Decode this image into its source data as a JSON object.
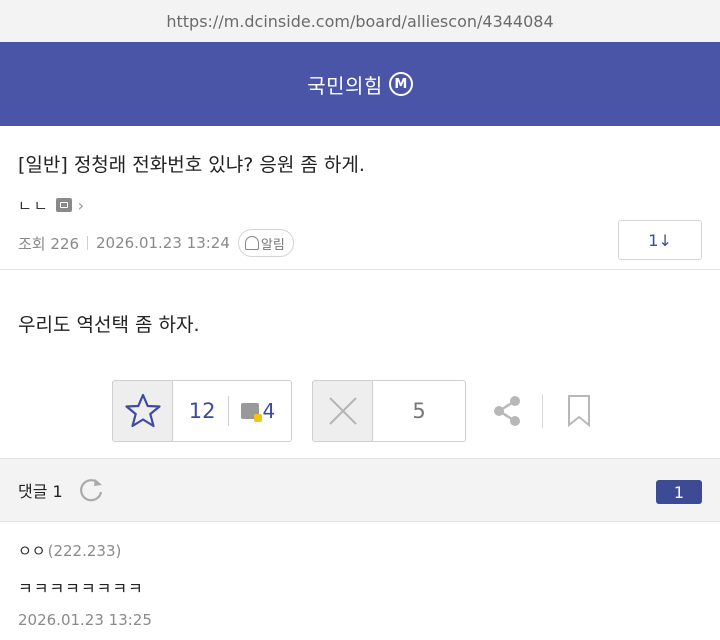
{
  "browser": {
    "url": "https://m.dcinside.com/board/alliescon/4344084"
  },
  "gallery": {
    "name": "국민의힘",
    "badge": "M"
  },
  "post": {
    "title": "[일반] 정청래 전화번호 있냐? 응원 좀 하게.",
    "author": "ㄴㄴ",
    "views_label": "조회 226",
    "date": "2026.01.23 13:24",
    "alarm_label": "알림",
    "comment_jump": "1↓",
    "body": "우리도 역선택 좀 하자."
  },
  "votes": {
    "recommend": "12",
    "fixed_recommend": "4",
    "not_recommend": "5"
  },
  "comments": {
    "label": "댓글 1",
    "count": "1",
    "items": [
      {
        "author": "ㅇㅇ",
        "ip": "(222.233)",
        "text": "ㅋㅋㅋㅋㅋㅋㅋㅋ",
        "date": "2026.01.23 13:25"
      }
    ]
  },
  "icons": [
    "refresh-icon",
    "share-icon",
    "bookmark-icon",
    "star-icon",
    "close-icon",
    "bell-icon"
  ],
  "colors": {
    "header": "#4a55a8",
    "accent": "#3d4aa0",
    "badge": "#3d4a94"
  }
}
